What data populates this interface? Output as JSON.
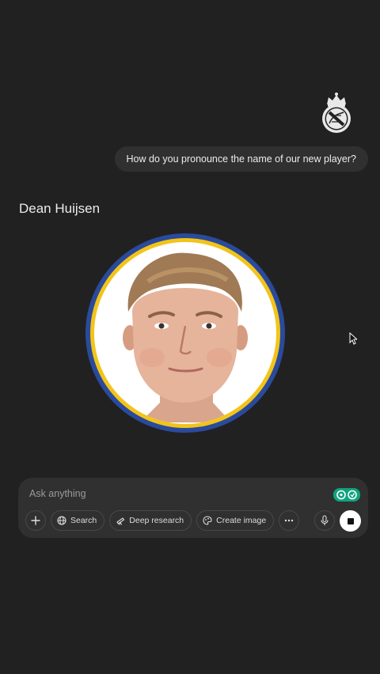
{
  "conversation": {
    "user_message": "How do you pronounce the name of our new player?",
    "answer_title": "Dean Huijsen"
  },
  "images": {
    "user_avatar": "real-madrid-crest",
    "player_portrait": "player-headshot",
    "portrait_ring_outer_color": "#2a4a9c",
    "portrait_ring_inner_color": "#f2c419"
  },
  "composer": {
    "placeholder": "Ask anything",
    "buttons": {
      "add": "plus-icon",
      "search": "Search",
      "deep_research": "Deep research",
      "create_image": "Create image",
      "more": "more-icon",
      "voice": "microphone-icon",
      "stop": "stop-icon"
    },
    "extension_badge": "extension-badge-icon"
  },
  "colors": {
    "background": "#212121",
    "bubble": "#303030",
    "text": "#ececec",
    "muted": "#9b9b9b",
    "badge": "#10a37f"
  }
}
